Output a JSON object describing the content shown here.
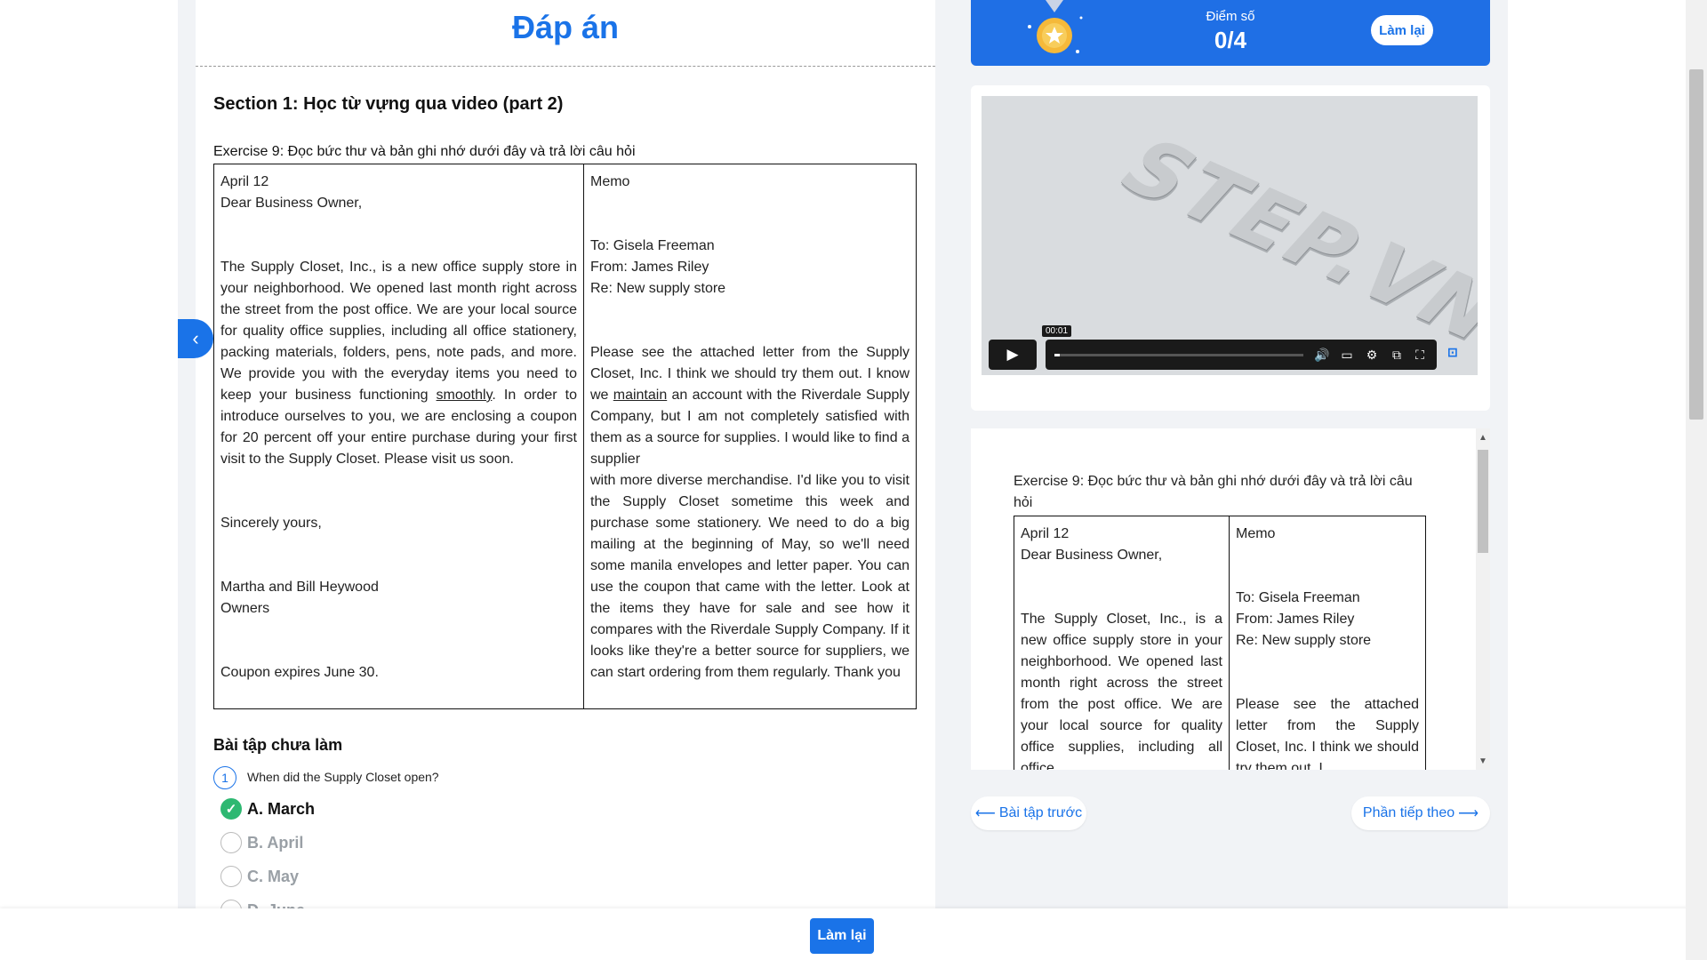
{
  "header": {
    "title": "Đáp án"
  },
  "section": {
    "title": "Section 1: Học từ vựng qua video (part 2)"
  },
  "exercise": {
    "title": "Exercise 9: Đọc bức thư và bản ghi nhớ dưới đây và trả lời câu hỏi",
    "letter": {
      "date": "April 12",
      "greeting": "Dear Business Owner,",
      "body_before": "The Supply Closet, Inc., is a new office supply store in your neighborhood. We opened last month right across the street from the post office. We are your local source for quality office supplies, including all office stationery, packing materials, folders, pens, note pads, and more. We provide you with the everyday items you need to keep your business functioning ",
      "body_underlined": "smoothly",
      "body_after": ". In order to introduce ourselves to you, we are enclosing a coupon for 20 percent off your entire purchase during your first visit to the Supply Closet. Please visit us soon.",
      "closing": "Sincerely yours,",
      "signature": "Martha and Bill Heywood",
      "signature_role": "Owners",
      "coupon_note": "Coupon expires June 30."
    },
    "memo": {
      "heading": "Memo",
      "to": "To: Gisela Freeman",
      "from": "From: James Riley",
      "re": "Re: New supply store",
      "body_before": "Please see the attached letter from the Supply Closet, Inc. I think we should try them out. I know we ",
      "body_underlined": "maintain",
      "body_middle": " an account with the Riverdale Supply Company, but I am not completely satisfied with them as a source for supplies. I would like to find a supplier",
      "body_after": "with more diverse merchandise. I'd like you to visit the Supply Closet sometime this week and purchase some stationery. We need to do a big mailing at the beginning of May, so we'll need some manila envelopes and letter paper. You can use the coupon that came with the letter. Look at the items they have for sale and see how it compares with the Riverdale Supply Company. If it looks like they're a better source for suppliers, we can start ordering from them regularly. Thank you"
    }
  },
  "questions": {
    "heading": "Bài tập chưa làm",
    "q1": {
      "number": "1",
      "text": "When did the Supply Closet open?",
      "options": [
        {
          "label": "A. March",
          "state": "correct"
        },
        {
          "label": "B. April",
          "state": "unselected"
        },
        {
          "label": "C. May",
          "state": "unselected"
        },
        {
          "label": "D. June",
          "state": "unselected"
        }
      ]
    }
  },
  "score": {
    "label": "Điểm số",
    "value": "0/4",
    "redo_label": "Làm lại"
  },
  "video": {
    "current_time": "00:01",
    "progress_fraction": 0.02,
    "watermark": "STEP.VN"
  },
  "reader": {
    "title": "Exercise 9: Đọc bức thư và bản ghi nhớ dưới đây và trả lời câu hỏi",
    "letter_date": "April 12",
    "letter_greeting": "Dear Business Owner,",
    "letter_body": "The Supply Closet, Inc., is a new office supply store in your neighborhood. We opened last month right across the street from the post office. We are your local source for quality office supplies, including all office",
    "memo_heading": "Memo",
    "memo_to": "To: Gisela Freeman",
    "memo_from": "From: James Riley",
    "memo_re": "Re: New supply store",
    "memo_body": "Please see the attached letter from the Supply Closet, Inc. I think we should try them out. I"
  },
  "nav": {
    "prev_label": "Bài tập trước",
    "next_label": "Phần tiếp theo"
  },
  "footer": {
    "redo_label": "Làm lại"
  },
  "colors": {
    "accent": "#1a73e8",
    "correct": "#2eb872"
  }
}
